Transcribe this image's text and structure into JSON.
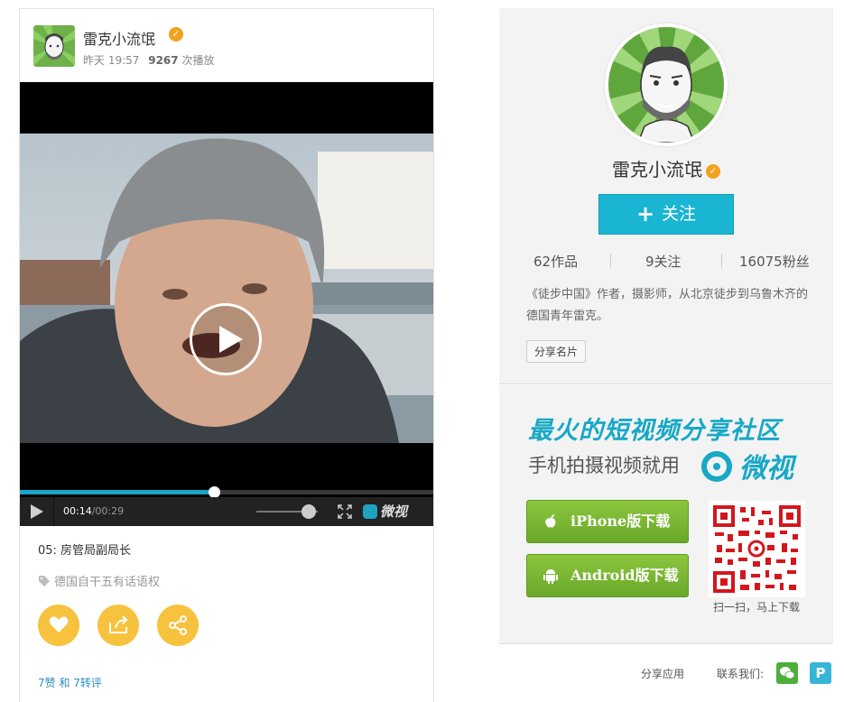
{
  "post": {
    "author": "雷克小流氓",
    "time": "昨天 19:57",
    "play_count": "9267",
    "play_label": "次播放"
  },
  "video": {
    "current_time": "00:14",
    "duration": "/00:29",
    "progress_fraction": 0.47,
    "brand": "微视"
  },
  "episode_title": "05: 房管局副局长",
  "tag": "德国自干五有话语权",
  "stats": {
    "text": "7赞 和 7转评"
  },
  "profile": {
    "name": "雷克小流氓",
    "follow_label": "关注",
    "works": "62作品",
    "following": "9关注",
    "followers": "16075粉丝",
    "bio": "《徒步中国》作者，摄影师，从北京徒步到乌鲁木齐的德国青年雷克。",
    "share_card_label": "分享名片"
  },
  "promo": {
    "title": "最火的短视频分享社区",
    "subtitle": "手机拍摄视频就用",
    "brand": "微视",
    "iphone_label": "iPhone版下载",
    "android_label": "Android版下载",
    "qr_caption": "扫一扫，马上下载"
  },
  "footer": {
    "share_app": "分享应用",
    "contact_us": "联系我们:"
  },
  "colors": {
    "accent": "#19b5d2",
    "badge": "#f2a21f",
    "action": "#f7c23d",
    "download": "#7ab733"
  }
}
